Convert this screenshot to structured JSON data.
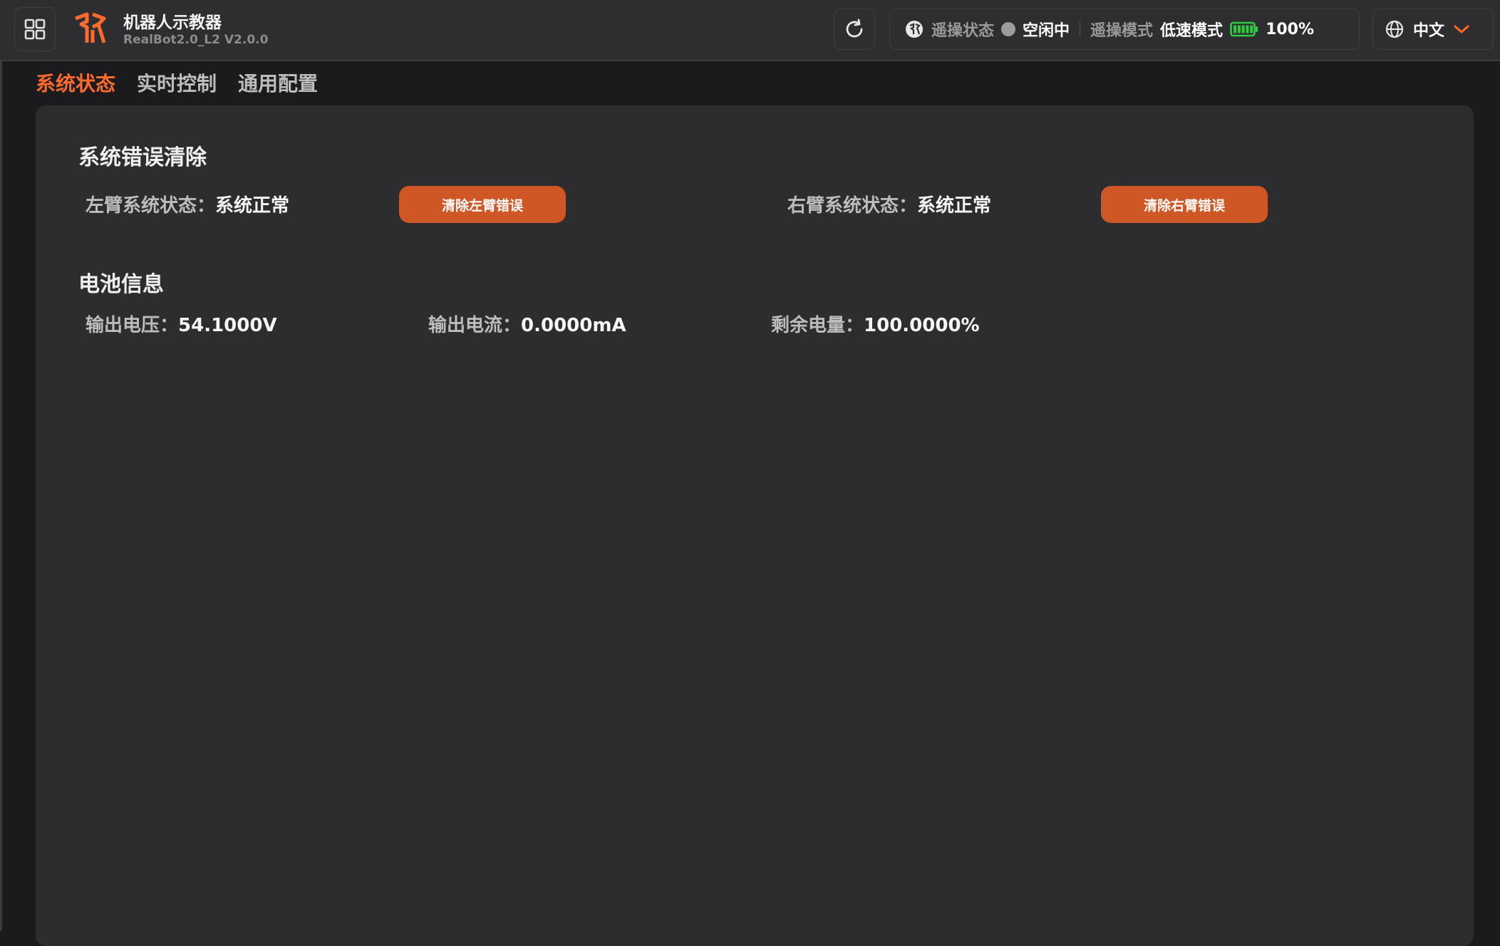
{
  "header": {
    "app_title": "机器人示教器",
    "app_version": "RealBot2.0_L2 V2.0.0",
    "teleop_status_label": "遥操状态",
    "teleop_status_value": "空闲中",
    "teleop_mode_label": "遥操模式",
    "teleop_mode_value": "低速模式",
    "battery_percent": "100%",
    "battery_level": 1.0,
    "language": "中文"
  },
  "tabs": [
    {
      "label": "系统状态",
      "active": true
    },
    {
      "label": "实时控制",
      "active": false
    },
    {
      "label": "通用配置",
      "active": false
    }
  ],
  "error_section": {
    "title": "系统错误清除",
    "left_label": "左臂系统状态：",
    "left_value": "系统正常",
    "left_button": "清除左臂错误",
    "right_label": "右臂系统状态：",
    "right_value": "系统正常",
    "right_button": "清除右臂错误"
  },
  "battery_section": {
    "title": "电池信息",
    "voltage_label": "输出电压：",
    "voltage_value": "54.1000V",
    "current_label": "输出电流：",
    "current_value": "0.0000mA",
    "remaining_label": "剩余电量：",
    "remaining_value": "100.0000%"
  },
  "colors": {
    "accent": "#ff6a2c",
    "button": "#cf5726",
    "battery_green": "#2ecc40",
    "background": "#1b1b1d",
    "panel": "#2d2d30"
  },
  "icons": {
    "menu": "grid-icon",
    "logo": "logo-icon",
    "refresh": "refresh-icon",
    "teleop": "teleop-icon",
    "battery": "battery-icon",
    "language": "globe-icon",
    "dropdown": "chevron-down-icon"
  }
}
